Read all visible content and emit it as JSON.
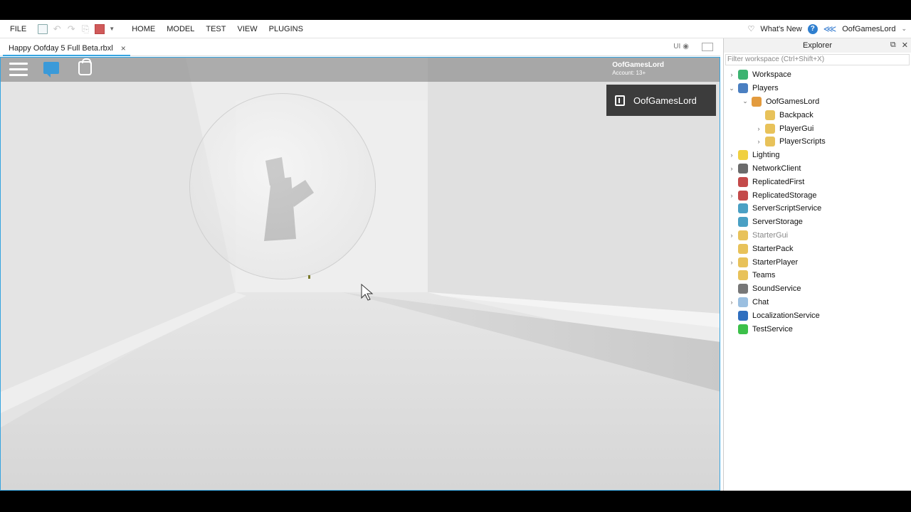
{
  "menu": {
    "file": "FILE",
    "items": [
      "HOME",
      "MODEL",
      "TEST",
      "VIEW",
      "PLUGINS"
    ],
    "whats_new": "What's New",
    "help": "?",
    "user": "OofGamesLord"
  },
  "tab": {
    "title": "Happy Oofday 5 Full Beta.rbxl",
    "close": "×",
    "ui_toggle": "UI"
  },
  "game": {
    "account_name": "OofGamesLord",
    "account_sub": "Account: 13+",
    "player_card_name": "OofGamesLord"
  },
  "explorer": {
    "title": "Explorer",
    "filter_placeholder": "Filter workspace (Ctrl+Shift+X)",
    "items": [
      {
        "label": "Workspace",
        "indent": 0,
        "arrow": "›",
        "icon_color": "#3cb371"
      },
      {
        "label": "Players",
        "indent": 0,
        "arrow": "⌄",
        "icon_color": "#4a7fc1"
      },
      {
        "label": "OofGamesLord",
        "indent": 1,
        "arrow": "⌄",
        "icon_color": "#e39b3e"
      },
      {
        "label": "Backpack",
        "indent": 2,
        "arrow": "",
        "icon_color": "#e8c25a"
      },
      {
        "label": "PlayerGui",
        "indent": 2,
        "arrow": "›",
        "icon_color": "#e8c25a"
      },
      {
        "label": "PlayerScripts",
        "indent": 2,
        "arrow": "›",
        "icon_color": "#e8c25a"
      },
      {
        "label": "Lighting",
        "indent": 0,
        "arrow": "›",
        "icon_color": "#f0d040"
      },
      {
        "label": "NetworkClient",
        "indent": 0,
        "arrow": "›",
        "icon_color": "#6b6b6b"
      },
      {
        "label": "ReplicatedFirst",
        "indent": 0,
        "arrow": "",
        "icon_color": "#c44a4a"
      },
      {
        "label": "ReplicatedStorage",
        "indent": 0,
        "arrow": "›",
        "icon_color": "#c44a4a"
      },
      {
        "label": "ServerScriptService",
        "indent": 0,
        "arrow": "",
        "icon_color": "#4aa0c4"
      },
      {
        "label": "ServerStorage",
        "indent": 0,
        "arrow": "",
        "icon_color": "#4aa0c4"
      },
      {
        "label": "StarterGui",
        "indent": 0,
        "arrow": "›",
        "icon_color": "#e8c25a",
        "dim": true
      },
      {
        "label": "StarterPack",
        "indent": 0,
        "arrow": "",
        "icon_color": "#e8c25a"
      },
      {
        "label": "StarterPlayer",
        "indent": 0,
        "arrow": "›",
        "icon_color": "#e8c25a"
      },
      {
        "label": "Teams",
        "indent": 0,
        "arrow": "",
        "icon_color": "#e8c25a"
      },
      {
        "label": "SoundService",
        "indent": 0,
        "arrow": "",
        "icon_color": "#777777"
      },
      {
        "label": "Chat",
        "indent": 0,
        "arrow": "›",
        "icon_color": "#9bbfe0"
      },
      {
        "label": "LocalizationService",
        "indent": 0,
        "arrow": "",
        "icon_color": "#2f6fbf"
      },
      {
        "label": "TestService",
        "indent": 0,
        "arrow": "",
        "icon_color": "#3cc04a"
      }
    ]
  }
}
